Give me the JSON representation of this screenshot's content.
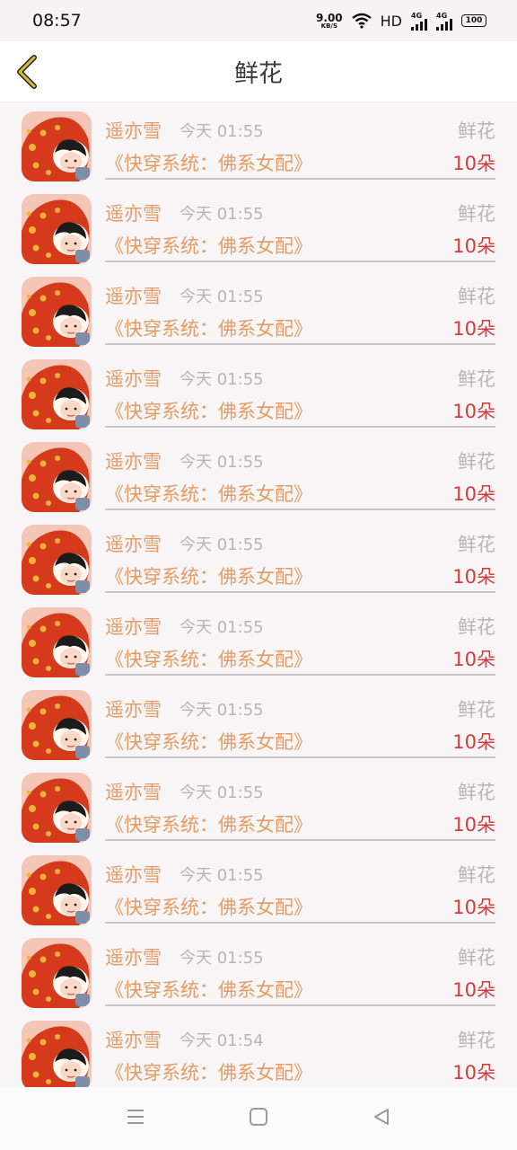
{
  "status": {
    "time": "08:57",
    "net_speed": "9.00",
    "net_unit": "KB/S",
    "hd": "HD",
    "sig1": "4G",
    "sig2": "4G",
    "battery": "100"
  },
  "header": {
    "title": "鲜花"
  },
  "icons": {
    "back": "chevron-left-icon",
    "menu": "menu-icon",
    "home": "home-square-icon",
    "nav_back": "triangle-back-icon"
  },
  "colors": {
    "name": "#e39a64",
    "count": "#d93a38",
    "muted": "#b8b4b6",
    "back_icon": "#e0c030"
  },
  "records": [
    {
      "user": "遥亦雪",
      "time": "今天 01:55",
      "type": "鲜花",
      "book": "《快穿系统：佛系女配》",
      "count": "10朵"
    },
    {
      "user": "遥亦雪",
      "time": "今天 01:55",
      "type": "鲜花",
      "book": "《快穿系统：佛系女配》",
      "count": "10朵"
    },
    {
      "user": "遥亦雪",
      "time": "今天 01:55",
      "type": "鲜花",
      "book": "《快穿系统：佛系女配》",
      "count": "10朵"
    },
    {
      "user": "遥亦雪",
      "time": "今天 01:55",
      "type": "鲜花",
      "book": "《快穿系统：佛系女配》",
      "count": "10朵"
    },
    {
      "user": "遥亦雪",
      "time": "今天 01:55",
      "type": "鲜花",
      "book": "《快穿系统：佛系女配》",
      "count": "10朵"
    },
    {
      "user": "遥亦雪",
      "time": "今天 01:55",
      "type": "鲜花",
      "book": "《快穿系统：佛系女配》",
      "count": "10朵"
    },
    {
      "user": "遥亦雪",
      "time": "今天 01:55",
      "type": "鲜花",
      "book": "《快穿系统：佛系女配》",
      "count": "10朵"
    },
    {
      "user": "遥亦雪",
      "time": "今天 01:55",
      "type": "鲜花",
      "book": "《快穿系统：佛系女配》",
      "count": "10朵"
    },
    {
      "user": "遥亦雪",
      "time": "今天 01:55",
      "type": "鲜花",
      "book": "《快穿系统：佛系女配》",
      "count": "10朵"
    },
    {
      "user": "遥亦雪",
      "time": "今天 01:55",
      "type": "鲜花",
      "book": "《快穿系统：佛系女配》",
      "count": "10朵"
    },
    {
      "user": "遥亦雪",
      "time": "今天 01:55",
      "type": "鲜花",
      "book": "《快穿系统：佛系女配》",
      "count": "10朵"
    },
    {
      "user": "遥亦雪",
      "time": "今天 01:54",
      "type": "鲜花",
      "book": "《快穿系统：佛系女配》",
      "count": "10朵"
    }
  ]
}
